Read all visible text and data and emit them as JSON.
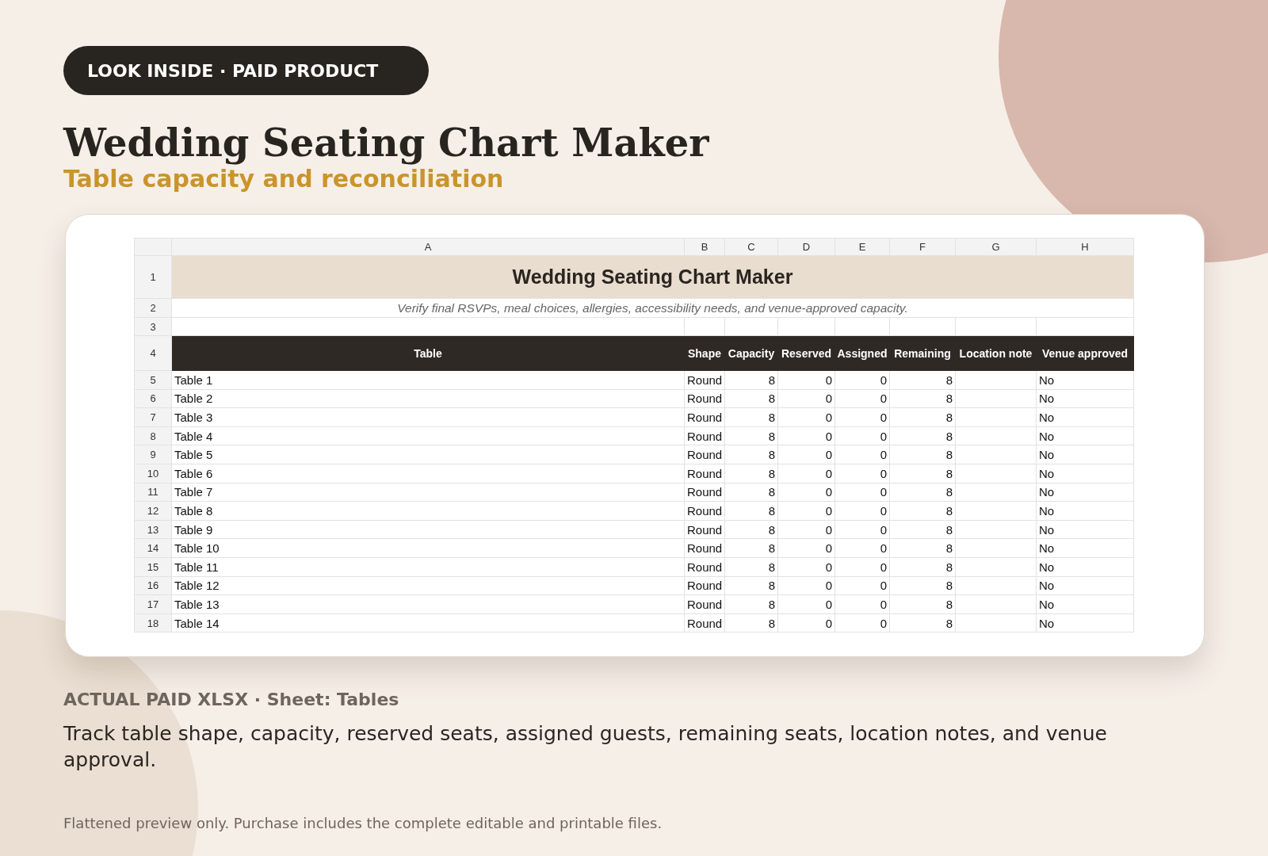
{
  "badge": {
    "label": "LOOK INSIDE · PAID PRODUCT"
  },
  "title": "Wedding Seating Chart Maker",
  "subtitle": "Table capacity and reconciliation",
  "sheet": {
    "column_letters": [
      "A",
      "B",
      "C",
      "D",
      "E",
      "F",
      "G",
      "H"
    ],
    "title_row": {
      "row_number": "1",
      "text": "Wedding Seating Chart Maker"
    },
    "note_row": {
      "row_number": "2",
      "text": "Verify final RSVPs, meal choices, allergies, accessibility needs, and venue-approved capacity."
    },
    "blank_row": {
      "row_number": "3"
    },
    "header_row": {
      "row_number": "4",
      "cells": [
        "Table",
        "Shape",
        "Capacity",
        "Reserved",
        "Assigned",
        "Remaining",
        "Location note",
        "Venue approved"
      ]
    },
    "rows": [
      {
        "row_number": "5",
        "table": "Table 1",
        "shape": "Round",
        "capacity": "8",
        "reserved": "0",
        "assigned": "0",
        "remaining": "8",
        "venue_approved": "No"
      },
      {
        "row_number": "6",
        "table": "Table 2",
        "shape": "Round",
        "capacity": "8",
        "reserved": "0",
        "assigned": "0",
        "remaining": "8",
        "venue_approved": "No"
      },
      {
        "row_number": "7",
        "table": "Table 3",
        "shape": "Round",
        "capacity": "8",
        "reserved": "0",
        "assigned": "0",
        "remaining": "8",
        "venue_approved": "No"
      },
      {
        "row_number": "8",
        "table": "Table 4",
        "shape": "Round",
        "capacity": "8",
        "reserved": "0",
        "assigned": "0",
        "remaining": "8",
        "venue_approved": "No"
      },
      {
        "row_number": "9",
        "table": "Table 5",
        "shape": "Round",
        "capacity": "8",
        "reserved": "0",
        "assigned": "0",
        "remaining": "8",
        "venue_approved": "No"
      },
      {
        "row_number": "10",
        "table": "Table 6",
        "shape": "Round",
        "capacity": "8",
        "reserved": "0",
        "assigned": "0",
        "remaining": "8",
        "venue_approved": "No"
      },
      {
        "row_number": "11",
        "table": "Table 7",
        "shape": "Round",
        "capacity": "8",
        "reserved": "0",
        "assigned": "0",
        "remaining": "8",
        "venue_approved": "No"
      },
      {
        "row_number": "12",
        "table": "Table 8",
        "shape": "Round",
        "capacity": "8",
        "reserved": "0",
        "assigned": "0",
        "remaining": "8",
        "venue_approved": "No"
      },
      {
        "row_number": "13",
        "table": "Table 9",
        "shape": "Round",
        "capacity": "8",
        "reserved": "0",
        "assigned": "0",
        "remaining": "8",
        "venue_approved": "No"
      },
      {
        "row_number": "14",
        "table": "Table 10",
        "shape": "Round",
        "capacity": "8",
        "reserved": "0",
        "assigned": "0",
        "remaining": "8",
        "venue_approved": "No"
      },
      {
        "row_number": "15",
        "table": "Table 11",
        "shape": "Round",
        "capacity": "8",
        "reserved": "0",
        "assigned": "0",
        "remaining": "8",
        "venue_approved": "No"
      },
      {
        "row_number": "16",
        "table": "Table 12",
        "shape": "Round",
        "capacity": "8",
        "reserved": "0",
        "assigned": "0",
        "remaining": "8",
        "venue_approved": "No"
      },
      {
        "row_number": "17",
        "table": "Table 13",
        "shape": "Round",
        "capacity": "8",
        "reserved": "0",
        "assigned": "0",
        "remaining": "8",
        "venue_approved": "No"
      },
      {
        "row_number": "18",
        "table": "Table 14",
        "shape": "Round",
        "capacity": "8",
        "reserved": "0",
        "assigned": "0",
        "remaining": "8",
        "venue_approved": "No"
      }
    ]
  },
  "caption": "ACTUAL PAID XLSX · Sheet: Tables",
  "description": "Track table shape, capacity, reserved seats, assigned guests, remaining seats, location notes, and venue approval.",
  "footnote": "Flattened preview only. Purchase includes the complete editable and printable files."
}
